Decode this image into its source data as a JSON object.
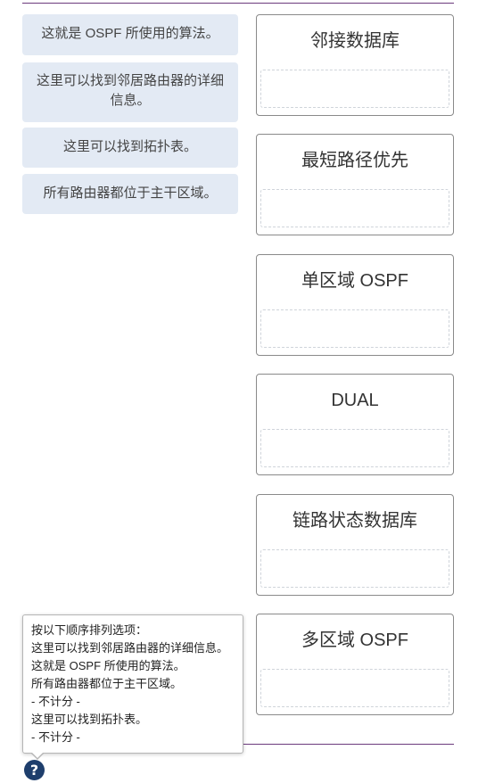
{
  "options": [
    {
      "label": "这就是 OSPF 所使用的算法。"
    },
    {
      "label": "这里可以找到邻居路由器的详细信息。"
    },
    {
      "label": "这里可以找到拓扑表。"
    },
    {
      "label": "所有路由器都位于主干区域。"
    }
  ],
  "targets": [
    {
      "label": "邻接数据库"
    },
    {
      "label": "最短路径优先"
    },
    {
      "label": "单区域 OSPF"
    },
    {
      "label": "DUAL"
    },
    {
      "label": "链路状态数据库"
    },
    {
      "label": "多区域 OSPF"
    }
  ],
  "tooltip": {
    "lines": [
      "按以下顺序排列选项：",
      "这里可以找到邻居路由器的详细信息。",
      "这就是 OSPF 所使用的算法。",
      "所有路由器都位于主干区域。",
      "- 不计分 -",
      "这里可以找到拓扑表。",
      "- 不计分 -"
    ]
  },
  "help": {
    "glyph": "?"
  },
  "colors": {
    "option_bg": "#e3eaf4",
    "rule": "#6b3a7d",
    "help_icon": "#1e3e6c"
  }
}
